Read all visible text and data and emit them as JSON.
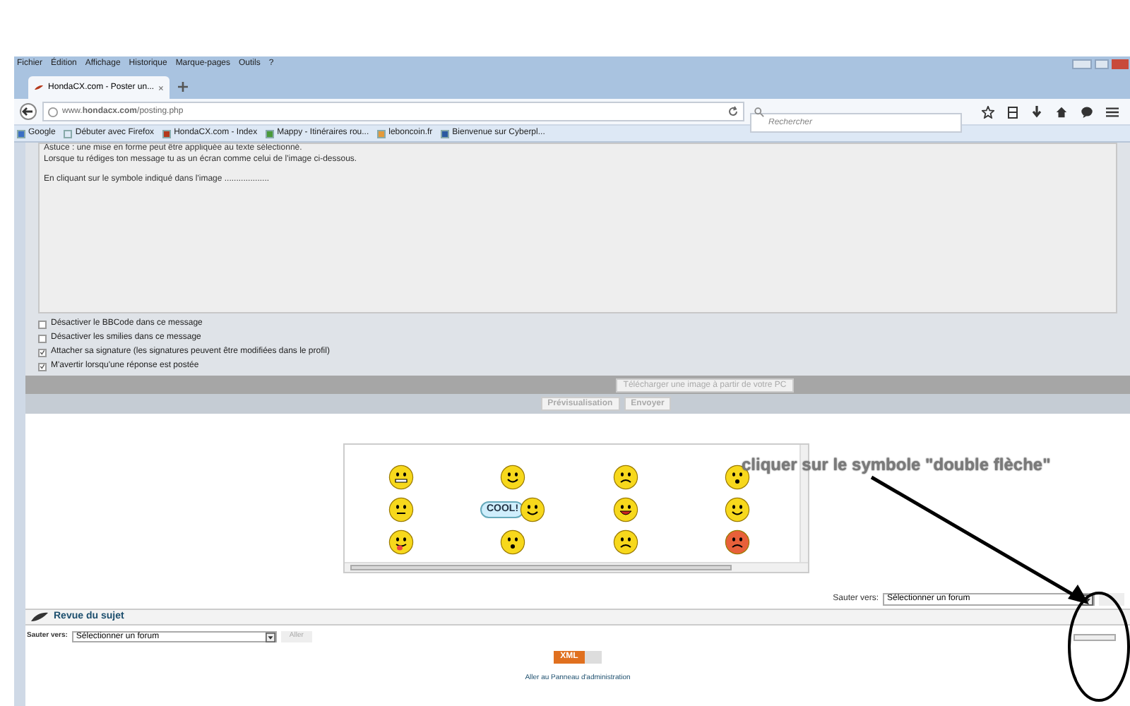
{
  "menu": [
    "Fichier",
    "Édition",
    "Affichage",
    "Historique",
    "Marque-pages",
    "Outils",
    "?"
  ],
  "tabs": [
    {
      "title": "HondaCX.com - Poster un...",
      "selected": true
    }
  ],
  "address": "www.**hondacx.com**/posting.php",
  "search": {
    "placeholder": "Rechercher"
  },
  "bookmarks": [
    "Google",
    "Débuter avec Firefox",
    "HondaCX.com - Index",
    "Mappy - Itinéraires rou...",
    "leboncoin.fr",
    "Bienvenue sur Cyberpl..."
  ],
  "message": [
    "Astuce : une mise en forme peut être appliquée au texte sélectionné.",
    "Lorsque tu rédiges ton message tu as un écran comme celui de l'image ci-dessous.",
    "En cliquant sur le symbole indiqué dans l'image ..................."
  ],
  "options": [
    {
      "label": "Désactiver le BBCode dans ce message",
      "checked": false
    },
    {
      "label": "Désactiver les smilies dans ce message",
      "checked": false
    },
    {
      "label": "Attacher sa signature (les signatures peuvent être modifiées dans le profil)",
      "checked": true
    },
    {
      "label": "M'avertir lorsqu'une réponse est postée",
      "checked": true
    }
  ],
  "upload_button": "Télécharger une image à partir de votre PC",
  "buttons": [
    "Prévisualisation",
    "Envoyer"
  ],
  "smilies": [
    {
      "kind": "grin"
    },
    {
      "kind": "smile"
    },
    {
      "kind": "sad"
    },
    {
      "kind": "wow"
    },
    {
      "kind": "talk"
    },
    {
      "kind": "cool",
      "label": "COOL!"
    },
    {
      "kind": "laugh"
    },
    {
      "kind": "smile"
    },
    {
      "kind": "tongue"
    },
    {
      "kind": "wow"
    },
    {
      "kind": "sad"
    },
    {
      "kind": "angry"
    }
  ],
  "annotation": "cliquer sur le symbole \"double flèche\"",
  "jump_top": {
    "label": "Sauter vers:",
    "value": "Sélectionner un forum"
  },
  "review": {
    "title": "Revue du sujet"
  },
  "jump_bottom": {
    "label": "Sauter vers:",
    "value": "Sélectionner un forum",
    "button": "Aller"
  },
  "feed_badge": "XML",
  "admin_link": "Aller au Panneau d'administration"
}
